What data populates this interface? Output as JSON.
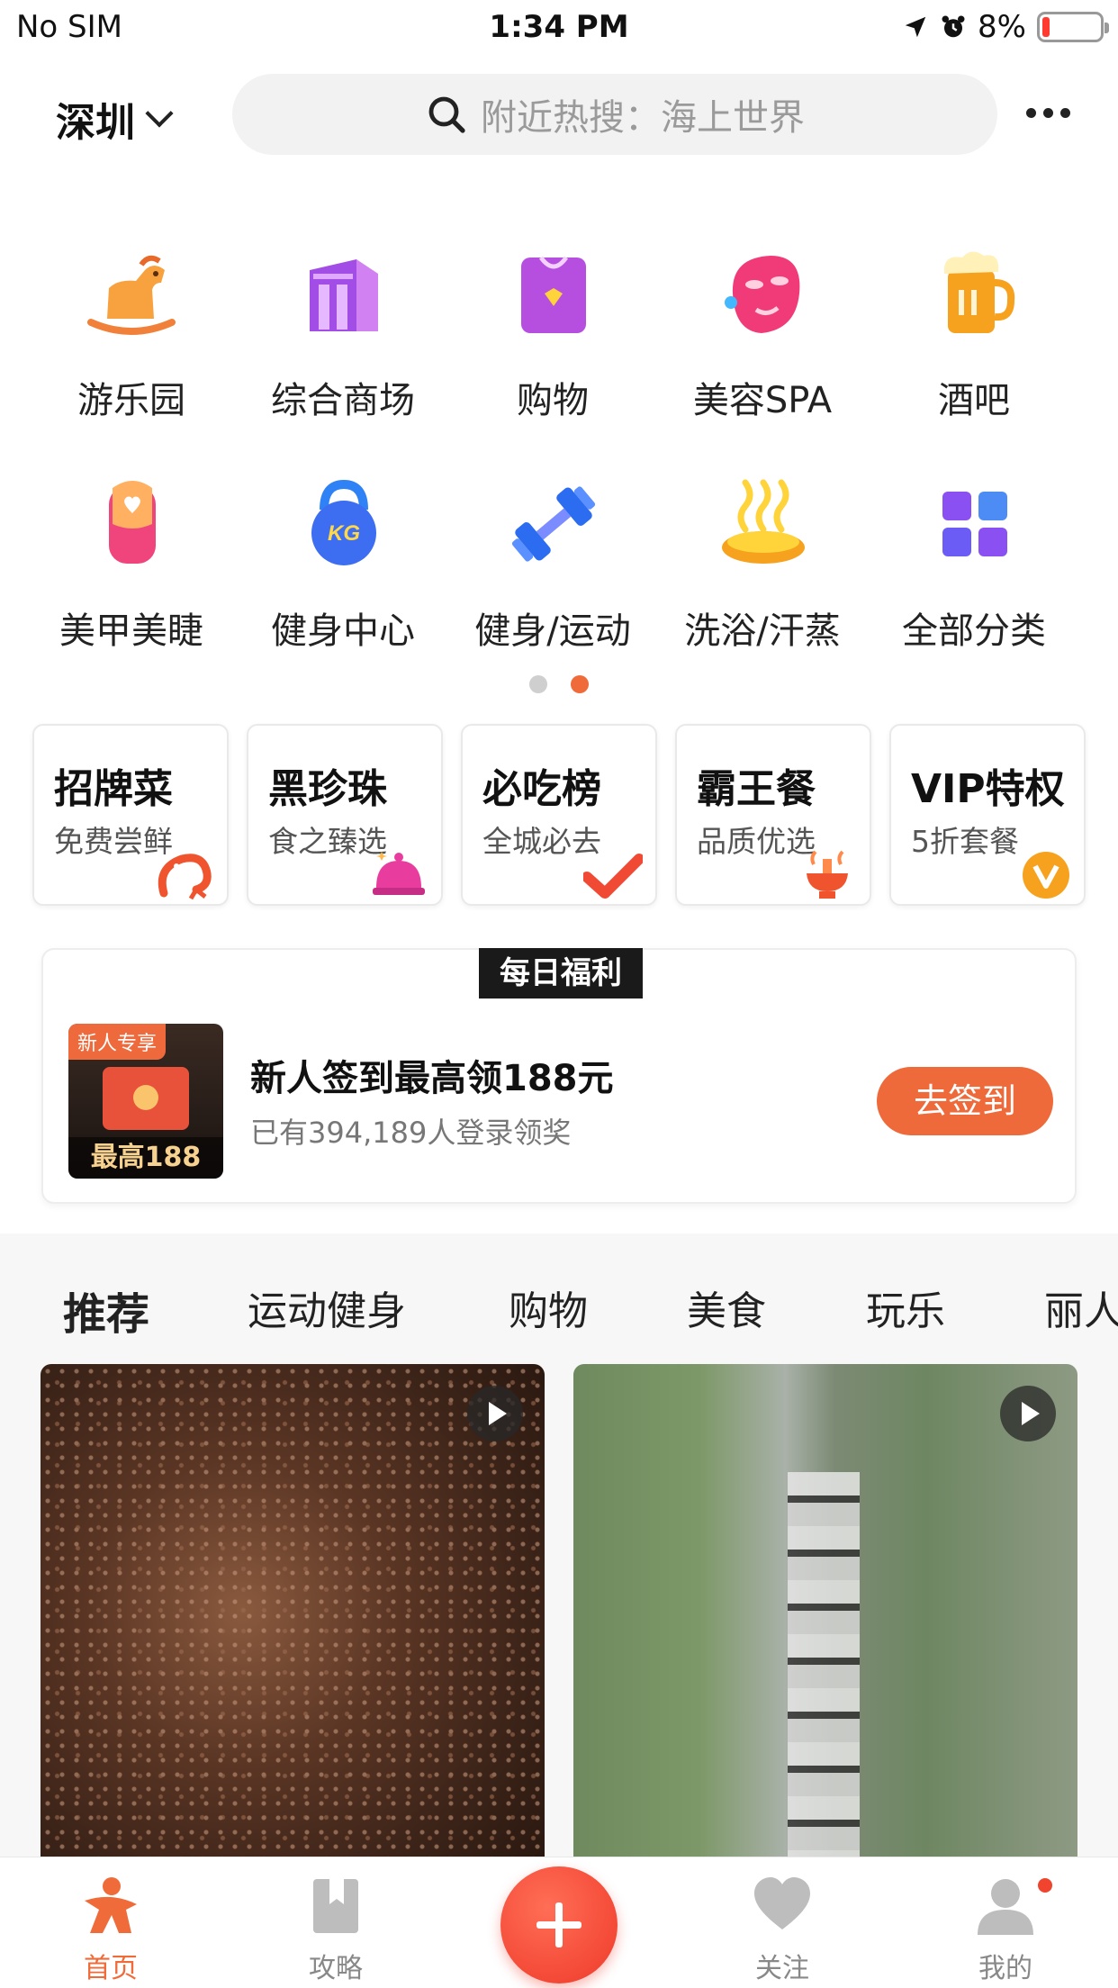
{
  "status_bar": {
    "carrier": "No SIM",
    "time": "1:34 PM",
    "battery": "8%"
  },
  "header": {
    "city": "深圳",
    "search_placeholder": "附近热搜：海上世界"
  },
  "categories": [
    {
      "label": "游乐园",
      "icon": "rocking-horse-icon"
    },
    {
      "label": "综合商场",
      "icon": "mall-building-icon"
    },
    {
      "label": "购物",
      "icon": "shopping-bag-icon"
    },
    {
      "label": "美容SPA",
      "icon": "face-mask-icon"
    },
    {
      "label": "酒吧",
      "icon": "beer-mug-icon"
    },
    {
      "label": "美甲美睫",
      "icon": "nail-icon"
    },
    {
      "label": "健身中心",
      "icon": "kettlebell-icon"
    },
    {
      "label": "健身/运动",
      "icon": "dumbbell-icon"
    },
    {
      "label": "洗浴/汗蒸",
      "icon": "hot-spring-icon"
    },
    {
      "label": "全部分类",
      "icon": "grid-icon"
    }
  ],
  "page_dots": {
    "count": 2,
    "active": 1
  },
  "promos": [
    {
      "title": "招牌菜",
      "sub": "免费尝鲜",
      "icon": "shrimp-icon"
    },
    {
      "title": "黑珍珠",
      "sub": "食之臻选",
      "icon": "cloche-icon"
    },
    {
      "title": "必吃榜",
      "sub": "全城必去",
      "icon": "checkmark-icon"
    },
    {
      "title": "霸王餐",
      "sub": "品质优选",
      "icon": "hotpot-icon"
    },
    {
      "title": "VIP特权",
      "sub": "5折套餐",
      "icon": "vip-badge-icon"
    }
  ],
  "welfare": {
    "tag": "每日福利",
    "badge": "新人专享",
    "image_text": "最高188",
    "title": "新人签到最高领188元",
    "subtitle": "已有394,189人登录领奖",
    "button": "去签到"
  },
  "tabs": [
    "推荐",
    "运动健身",
    "购物",
    "美食",
    "玩乐",
    "丽人"
  ],
  "active_tab": 0,
  "bottom_nav": [
    {
      "label": "首页",
      "icon": "home-person-icon",
      "active": true
    },
    {
      "label": "攻略",
      "icon": "bookmark-icon",
      "active": false
    },
    {
      "label": "关注",
      "icon": "heart-icon",
      "active": false
    },
    {
      "label": "我的",
      "icon": "profile-icon",
      "active": false
    }
  ],
  "colors": {
    "accent": "#f06b3a",
    "fab": "#ef3a2a",
    "battery_low": "#ff3b30"
  }
}
